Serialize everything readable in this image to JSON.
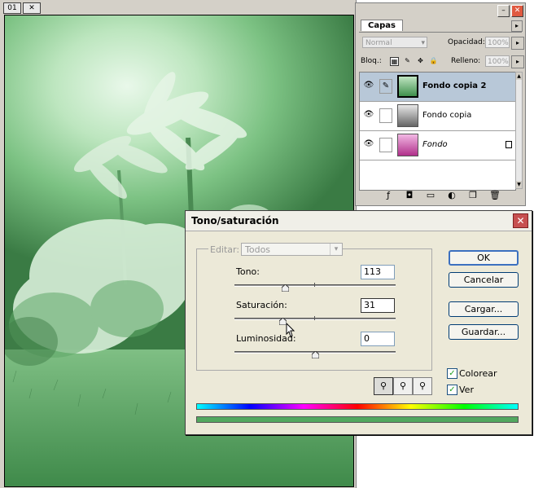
{
  "document": {
    "tabs": [
      "01",
      "✕"
    ]
  },
  "layers_panel": {
    "tab_label": "Capas",
    "blend_mode": "Normal",
    "opacity_label": "Opacidad:",
    "opacity_value": "100%",
    "lock_label": "Bloq.:",
    "fill_label": "Relleno:",
    "fill_value": "100%",
    "layers": [
      {
        "name": "Fondo copia 2",
        "selected": true
      },
      {
        "name": "Fondo copia",
        "selected": false
      },
      {
        "name": "Fondo",
        "selected": false
      }
    ]
  },
  "dialog": {
    "title": "Tono/saturación",
    "edit_label": "Editar:",
    "edit_value": "Todos",
    "hue_label": "Tono:",
    "hue_value": "113",
    "saturation_label": "Saturación:",
    "saturation_value": "31",
    "lightness_label": "Luminosidad:",
    "lightness_value": "0",
    "buttons": {
      "ok": "OK",
      "cancel": "Cancelar",
      "load": "Cargar...",
      "save": "Guardar..."
    },
    "colorize_label": "Colorear",
    "colorize_checked": true,
    "preview_label": "Ver",
    "preview_checked": true
  },
  "colors": {
    "tint_green": "#52a85f",
    "accent_blue": "#3c70c0",
    "close_red": "#c75050"
  }
}
